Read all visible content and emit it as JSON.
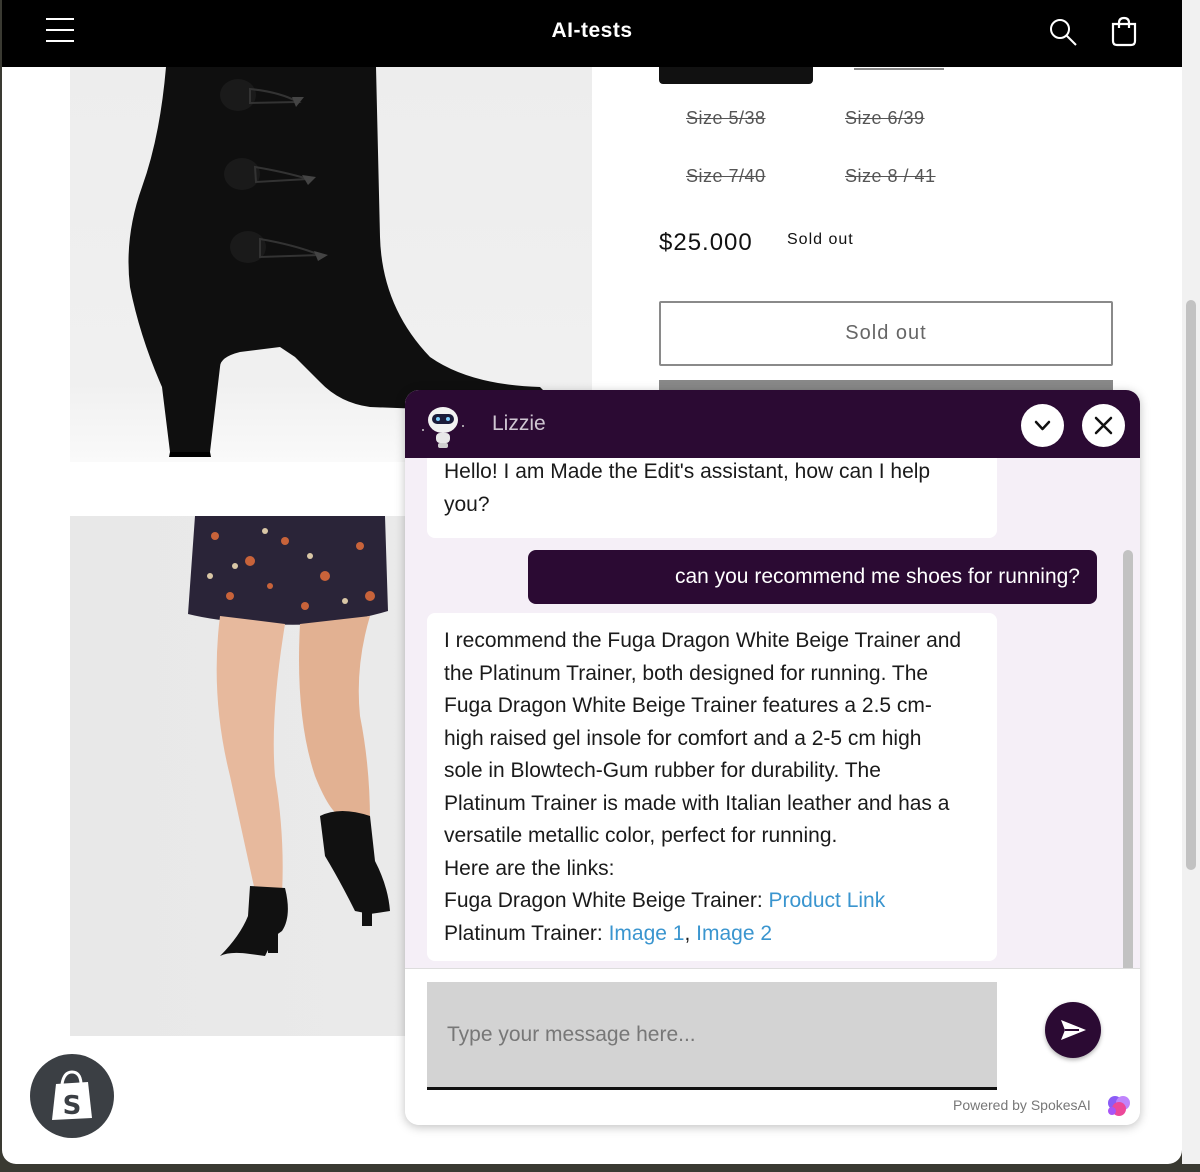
{
  "header": {
    "store_title": "AI-tests",
    "menu_icon": "hamburger-menu-icon",
    "search_icon": "search-icon",
    "cart_icon": "cart-icon"
  },
  "product": {
    "sizes": [
      {
        "label": "Size 5/38",
        "available": false
      },
      {
        "label": "Size 6/39",
        "available": false
      },
      {
        "label": "Size 7/40",
        "available": false
      },
      {
        "label": "Size 8 / 41",
        "available": false
      }
    ],
    "price": "$25.000",
    "status_badge": "Sold out",
    "sold_out_button": "Sold out"
  },
  "chat": {
    "bot_name": "Lizzie",
    "messages": {
      "greeting": "Hello! I am Made the Edit's assistant, how can I help you?",
      "user_question": "can you recommend me shoes for running?",
      "reply_lines": [
        "I recommend the Fuga Dragon White Beige Trainer and",
        "the Platinum Trainer, both designed for running. The",
        "Fuga Dragon White Beige Trainer features a 2.5 cm-",
        "high raised gel insole for comfort and a 2-5 cm high",
        "sole in Blowtech-Gum rubber for durability. The",
        "Platinum Trainer is made with Italian leather and has a",
        "versatile metallic color, perfect for running.",
        "Here are the links:"
      ],
      "link_line_1_prefix": "Fuga Dragon White Beige Trainer: ",
      "link_line_1_link": "Product Link",
      "link_line_2_prefix": "Platinum Trainer: ",
      "link_line_2_link_a": "Image 1",
      "link_line_2_sep": ", ",
      "link_line_2_link_b": "Image 2"
    },
    "input_placeholder": "Type your message here...",
    "powered_by": "Powered by SpokesAI"
  },
  "colors": {
    "chat_brand": "#2b0a33",
    "chat_background": "#f5eff7",
    "link": "#3a95cf",
    "header_bg": "#000000"
  }
}
